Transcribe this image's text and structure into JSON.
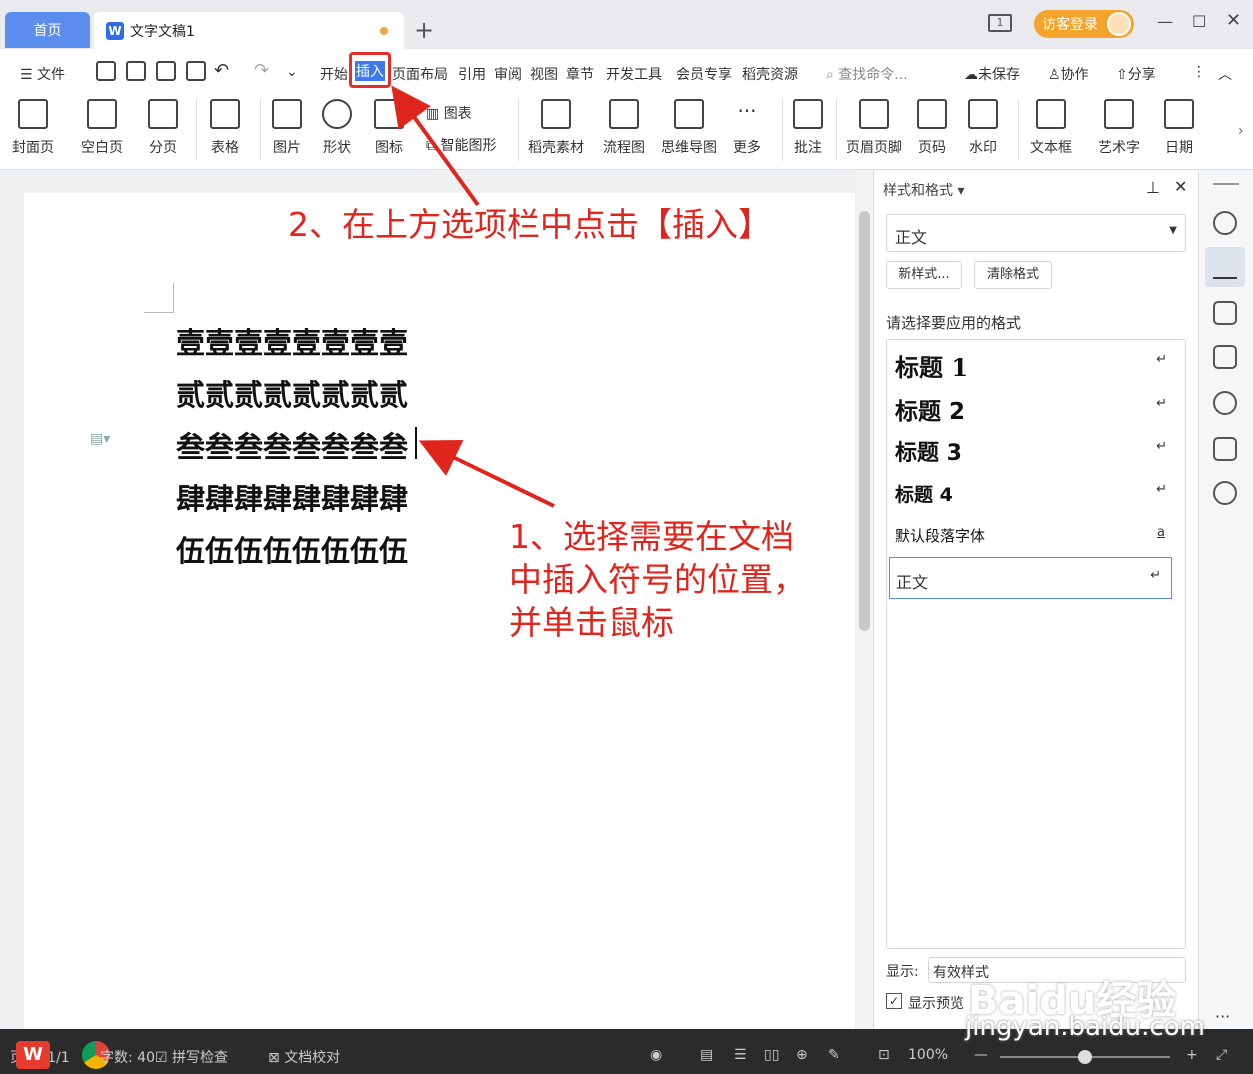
{
  "titlebar": {
    "home_tab": "首页",
    "doc_tab": "文字文稿1",
    "login_button": "访客登录"
  },
  "menubar": {
    "file": "文件",
    "tabs": [
      "开始",
      "插入",
      "页面布局",
      "引用",
      "审阅",
      "视图",
      "章节",
      "开发工具",
      "会员专享",
      "稻壳资源"
    ],
    "search_placeholder": "查找命令...",
    "unsaved": "未保存",
    "collab": "协作",
    "share": "分享"
  },
  "ribbon": {
    "buttons": [
      "封面页",
      "空白页",
      "分页",
      "表格",
      "图片",
      "形状",
      "图标",
      "图表",
      "智能图形",
      "稻壳素材",
      "流程图",
      "思维导图",
      "更多",
      "批注",
      "页眉页脚",
      "页码",
      "水印",
      "文本框",
      "艺术字",
      "日期"
    ]
  },
  "document": {
    "lines": [
      "壹壹壹壹壹壹壹壹",
      "贰贰贰贰贰贰贰贰",
      "叁叁叁叁叁叁叁叁",
      "肆肆肆肆肆肆肆肆",
      "伍伍伍伍伍伍伍伍"
    ]
  },
  "annotations": {
    "step2": "2、在上方选项栏中点击【插入】",
    "step1_line1": "1、选择需要在文档",
    "step1_line2": "中插入符号的位置，",
    "step1_line3": "并单击鼠标",
    "color": "#e0251d"
  },
  "panel": {
    "title": "样式和格式",
    "current_style": "正文",
    "new_style_btn": "新样式...",
    "clear_format_btn": "清除格式",
    "apply_label": "请选择要应用的格式",
    "styles": [
      {
        "name": "标题  1"
      },
      {
        "name": "标题  2"
      },
      {
        "name": "标题  3"
      },
      {
        "name": "标题  4"
      },
      {
        "name": "默认段落字体"
      },
      {
        "name": "正文"
      }
    ],
    "show_label": "显示:",
    "show_value": "有效样式",
    "preview_label": "显示预览"
  },
  "statusbar": {
    "page": "页面: 1/1",
    "words": "字数: 40",
    "spell": "拼写检查",
    "proof": "文档校对",
    "zoom": "100%"
  },
  "watermark": {
    "brand": "Baidu经验",
    "url": "jingyan.baidu.com"
  }
}
